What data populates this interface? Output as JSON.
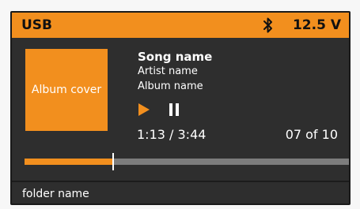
{
  "header": {
    "source": "USB",
    "bluetooth_icon": "bluetooth-icon",
    "voltage": "12.5 V"
  },
  "album_cover": {
    "label": "Album cover"
  },
  "track": {
    "song": "Song name",
    "artist": "Artist name",
    "album": "Album name"
  },
  "controls": {
    "play_icon": "play-icon",
    "pause_icon": "pause-icon"
  },
  "playback": {
    "time": "1:13 / 3:44",
    "track_count": "07 of 10",
    "progress": 0.27
  },
  "folder": {
    "name": "folder name"
  },
  "colors": {
    "accent": "#f28f1e",
    "background": "#2e2e2e",
    "track": "#7c7c7c",
    "text": "#ffffff"
  }
}
